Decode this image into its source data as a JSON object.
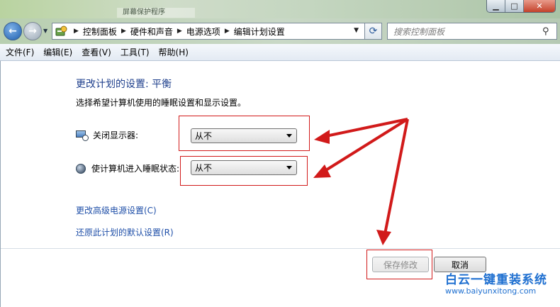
{
  "window": {
    "ghost_title": "屏幕保护程序"
  },
  "nav": {
    "breadcrumbs": [
      "控制面板",
      "硬件和声音",
      "电源选项",
      "编辑计划设置"
    ],
    "search_placeholder": "搜索控制面板"
  },
  "menu": [
    "文件(F)",
    "编辑(E)",
    "查看(V)",
    "工具(T)",
    "帮助(H)"
  ],
  "content": {
    "heading": "更改计划的设置: 平衡",
    "description": "选择希望计算机使用的睡眠设置和显示设置。",
    "settings": [
      {
        "label": "关闭显示器:",
        "value": "从不",
        "icon": "monitor-clock-icon"
      },
      {
        "label": "使计算机进入睡眠状态:",
        "value": "从不",
        "icon": "moon-icon"
      }
    ],
    "links": [
      "更改高级电源设置(C)",
      "还原此计划的默认设置(R)"
    ],
    "buttons": {
      "save": "保存修改",
      "cancel": "取消"
    }
  },
  "annotations": {
    "highlight_color": "#d11a1a"
  },
  "watermark": {
    "brand": "白云一键重装系统",
    "url": "www.baiyunxitong.com"
  }
}
